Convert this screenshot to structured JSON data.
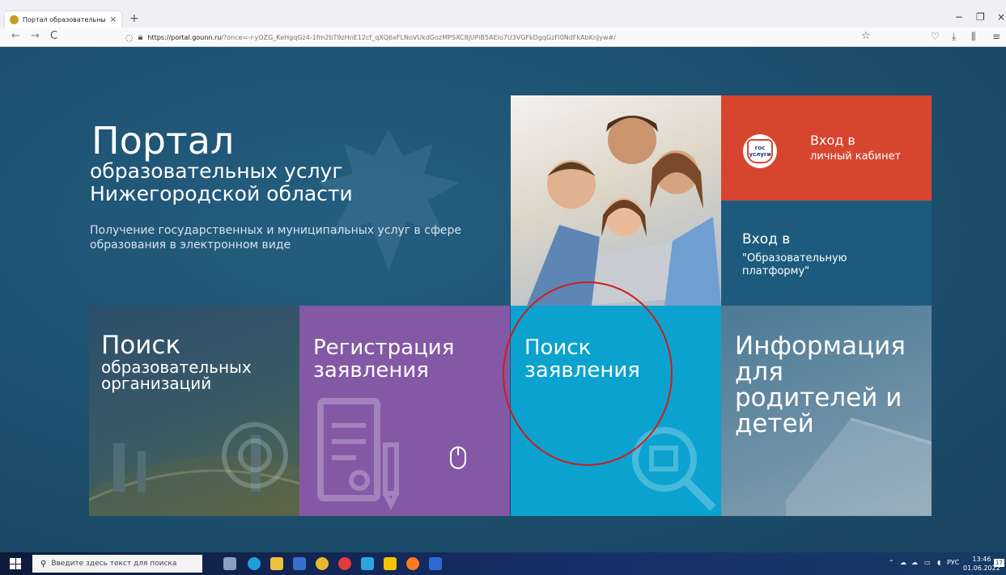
{
  "browser": {
    "tab_title": "Портал образовательных усл",
    "tab_close": "×",
    "new_tab": "+",
    "url_host": "https://portal.gounn.ru",
    "url_path": "/?once=-r-yOZG_KeHgqGz4-1fm2bT9zHnE12cf_qXQ6xFLNoVUkdGozMPSXC8jUPiB5AElo7U3VGFkDgqGzFi0NdFkAbKnJyw#/",
    "window_minimize": "−",
    "window_restore": "❐",
    "window_close": "×",
    "back": "←",
    "forward": "→",
    "reload": "C"
  },
  "hero": {
    "title": "Портал",
    "subtitle": "образовательных услуг Нижегородской области",
    "description": "Получение государственных и муниципальных услуг в сфере образования в электронном виде"
  },
  "tiles": {
    "gos": {
      "logo_top": "гос",
      "logo_bottom": "услуги",
      "line1": "Вход в",
      "line2": "личный кабинет"
    },
    "platform": {
      "line1": "Вход в",
      "line2": "\"Образовательную платформу\""
    },
    "search_org": {
      "big": "Поиск",
      "small": "образовательных организаций"
    },
    "registration": {
      "label": "Регистрация заявления"
    },
    "search_app": {
      "label": "Поиск заявления"
    },
    "info": {
      "label": "Информация для родителей и детей"
    }
  },
  "taskbar": {
    "search_placeholder": "Введите здесь текст для поиска",
    "lang": "РУС",
    "time": "13:46",
    "date": "01.06.2022",
    "notif_count": "17"
  },
  "colors": {
    "page_bg": "#1d5170",
    "gos_tile": "#d8452f",
    "registration_tile": "#8359a6",
    "search_app_tile": "#0ba2cf",
    "annotation_circle": "#d21a1a"
  }
}
